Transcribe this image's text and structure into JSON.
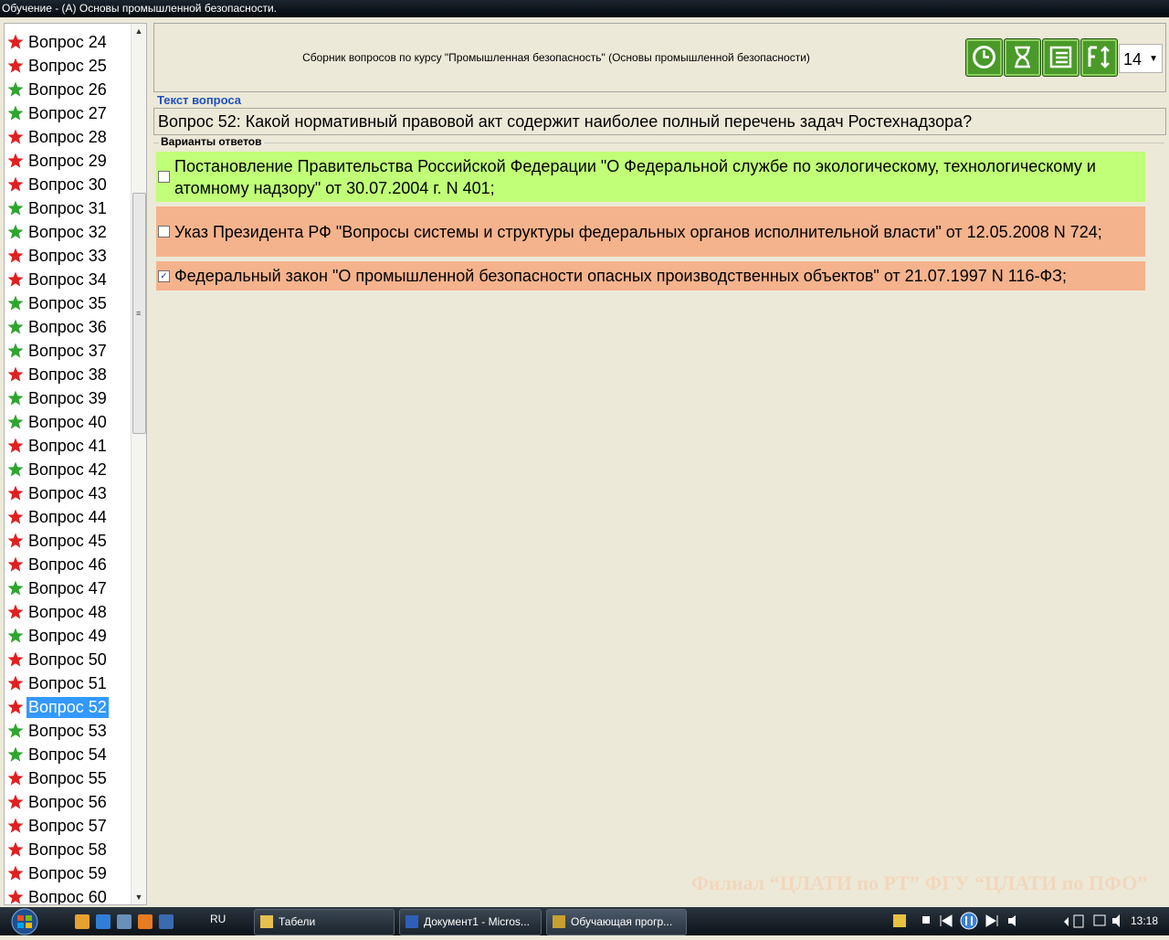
{
  "window": {
    "title": "Обучение - (А) Основы промышленной безопасности."
  },
  "question_list": {
    "items": [
      {
        "label": "Вопрос 24",
        "status": "wrong"
      },
      {
        "label": "Вопрос 25",
        "status": "wrong"
      },
      {
        "label": "Вопрос 26",
        "status": "correct"
      },
      {
        "label": "Вопрос 27",
        "status": "correct"
      },
      {
        "label": "Вопрос 28",
        "status": "wrong"
      },
      {
        "label": "Вопрос 29",
        "status": "wrong"
      },
      {
        "label": "Вопрос 30",
        "status": "wrong"
      },
      {
        "label": "Вопрос 31",
        "status": "correct"
      },
      {
        "label": "Вопрос 32",
        "status": "correct"
      },
      {
        "label": "Вопрос 33",
        "status": "wrong"
      },
      {
        "label": "Вопрос 34",
        "status": "wrong"
      },
      {
        "label": "Вопрос 35",
        "status": "correct"
      },
      {
        "label": "Вопрос 36",
        "status": "correct"
      },
      {
        "label": "Вопрос 37",
        "status": "correct"
      },
      {
        "label": "Вопрос 38",
        "status": "wrong"
      },
      {
        "label": "Вопрос 39",
        "status": "correct"
      },
      {
        "label": "Вопрос 40",
        "status": "correct"
      },
      {
        "label": "Вопрос 41",
        "status": "wrong"
      },
      {
        "label": "Вопрос 42",
        "status": "correct"
      },
      {
        "label": "Вопрос 43",
        "status": "wrong"
      },
      {
        "label": "Вопрос 44",
        "status": "wrong"
      },
      {
        "label": "Вопрос 45",
        "status": "wrong"
      },
      {
        "label": "Вопрос 46",
        "status": "wrong"
      },
      {
        "label": "Вопрос 47",
        "status": "correct"
      },
      {
        "label": "Вопрос 48",
        "status": "wrong"
      },
      {
        "label": "Вопрос 49",
        "status": "correct"
      },
      {
        "label": "Вопрос 50",
        "status": "wrong"
      },
      {
        "label": "Вопрос 51",
        "status": "wrong"
      },
      {
        "label": "Вопрос 52",
        "status": "wrong",
        "selected": true
      },
      {
        "label": "Вопрос 53",
        "status": "correct"
      },
      {
        "label": "Вопрос 54",
        "status": "correct"
      },
      {
        "label": "Вопрос 55",
        "status": "wrong"
      },
      {
        "label": "Вопрос 56",
        "status": "wrong"
      },
      {
        "label": "Вопрос 57",
        "status": "wrong"
      },
      {
        "label": "Вопрос 58",
        "status": "wrong"
      },
      {
        "label": "Вопрос 59",
        "status": "wrong"
      },
      {
        "label": "Вопрос 60",
        "status": "wrong"
      }
    ],
    "scroll_grip": "≡"
  },
  "header": {
    "course_title": "Сборник вопросов по курсу \"Промышленная безопасность\" (Основы промышленной безопасности)",
    "font_size_value": "14",
    "toolbar_icons": [
      "clock-icon",
      "hourglass-icon",
      "list-icon",
      "font-size-icon"
    ]
  },
  "question": {
    "section_label": "Текст вопроса",
    "text": "Вопрос 52: Какой нормативный правовой акт содержит наиболее полный перечень задач Ростехнадзора?"
  },
  "answers": {
    "section_label": "Варианты ответов",
    "options": [
      {
        "text": "Постановление Правительства Российской Федерации \"О Федеральной службе по экологическому, технологическому и атомному надзору\" от 30.07.2004 г. N 401;",
        "checked": false,
        "color": "#c0ff77"
      },
      {
        "text": "Указ Президента РФ \"Вопросы системы и структуры федеральных органов исполнительной власти\" от 12.05.2008 N 724;",
        "checked": false,
        "color": "#f5b38d"
      },
      {
        "text": "Федеральный закон \"О промышленной безопасности опасных производственных объектов\" от 21.07.1997 N 116-ФЗ;",
        "checked": true,
        "color": "#f5b38d"
      }
    ]
  },
  "watermark": "Филиал “ЦЛАТИ по РТ” ФГУ “ЦЛАТИ по ПФО”",
  "colors": {
    "correct_star": "#2fa52f",
    "wrong_star": "#e02020",
    "selection": "#3399ff",
    "label_blue": "#1f4fbf"
  },
  "taskbar": {
    "language": "RU",
    "tasks": [
      {
        "label": "Табели",
        "icon": "folder-icon"
      },
      {
        "label": "Документ1 - Micros...",
        "icon": "word-icon"
      },
      {
        "label": "Обучающая прогр...",
        "icon": "app-icon"
      }
    ],
    "clock": "13:18"
  }
}
